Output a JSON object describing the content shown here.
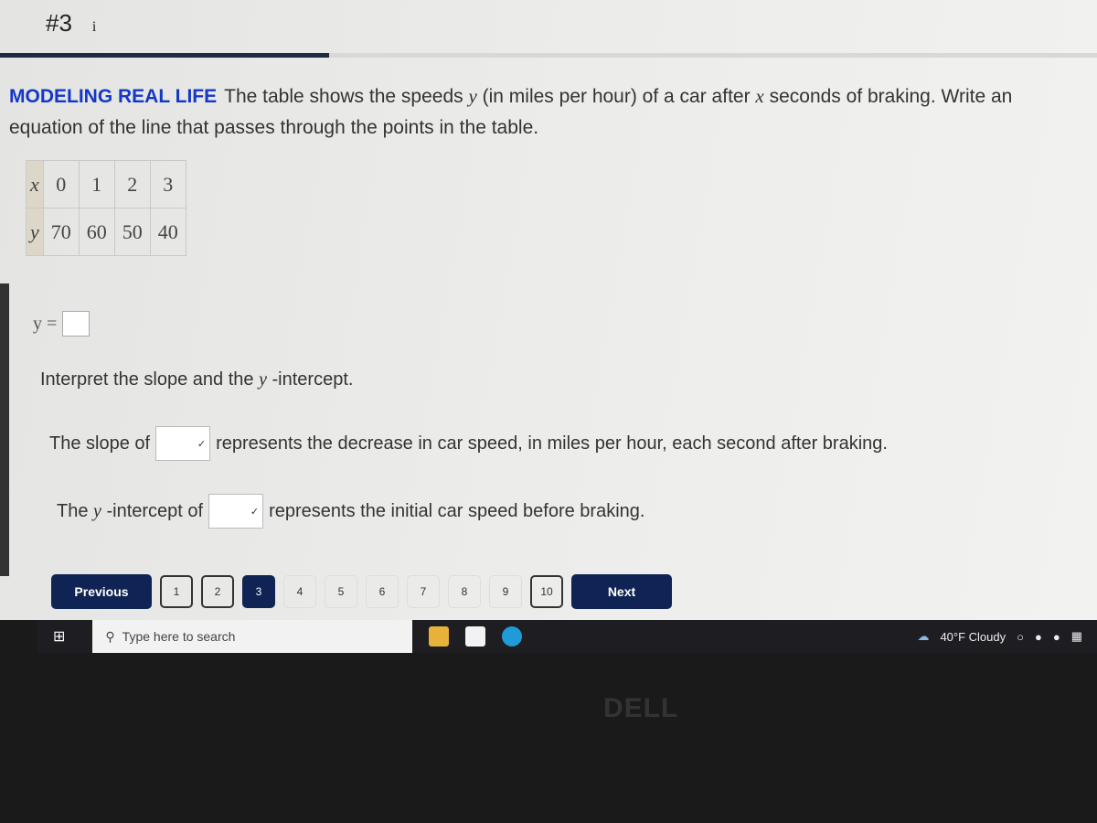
{
  "header": {
    "problem_number": "#3",
    "info_icon": "i"
  },
  "progress": {
    "fraction": 0.3
  },
  "question": {
    "tag": "MODELING REAL LIFE",
    "text_parts": [
      "The table shows the speeds ",
      "y",
      " (in miles per hour) of a car after ",
      "x",
      " seconds of braking. Write an equation of the line that passes through the points in the table."
    ]
  },
  "table": {
    "x_label": "x",
    "y_label": "y",
    "x": [
      "0",
      "1",
      "2",
      "3"
    ],
    "y": [
      "70",
      "60",
      "50",
      "40"
    ]
  },
  "equation": {
    "label": "y =",
    "value": ""
  },
  "interpret": {
    "parts": [
      "Interpret the slope and the ",
      "y",
      " -intercept."
    ]
  },
  "slope_line": {
    "before": "The slope of",
    "after": "represents the decrease in car speed, in miles per hour, each second after braking.",
    "selected": ""
  },
  "intercept_line": {
    "before_a": "The ",
    "var": "y",
    "before_b": " -intercept of",
    "after": "represents the initial car speed before braking.",
    "selected": ""
  },
  "pager": {
    "previous": "Previous",
    "next": "Next",
    "pages": [
      "1",
      "2",
      "3",
      "4",
      "5",
      "6",
      "7",
      "8",
      "9",
      "10"
    ],
    "current": "3"
  },
  "taskbar": {
    "search_placeholder": "Type here to search",
    "weather": "40°F Cloudy"
  },
  "brand": "DELL"
}
